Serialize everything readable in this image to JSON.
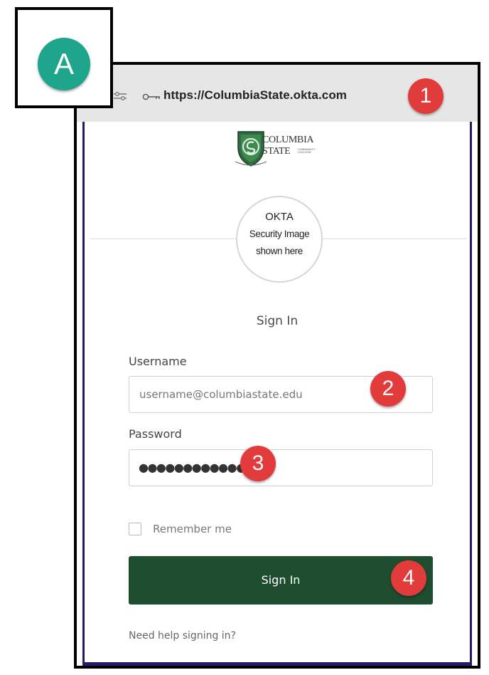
{
  "browser": {
    "url": "https://ColumbiaState.okta.com",
    "tune_icon": "tune-icon",
    "key_icon": "key-icon"
  },
  "logo": {
    "line1": "COLUMBIA",
    "line2": "STATE",
    "small_text": "COMMUNITY COLLEGE",
    "emblem": "cs-shield-logo"
  },
  "security_image": {
    "line1": "OKTA",
    "line2": "Security Image",
    "line3": "shown here"
  },
  "form": {
    "heading": "Sign In",
    "username_label": "Username",
    "username_value": "username@columbiastate.edu",
    "password_label": "Password",
    "password_mask": "●●●●●●●●●●●●",
    "remember_label": "Remember me",
    "remember_checked": false,
    "submit_label": "Sign In",
    "help_link": "Need help signing in?"
  },
  "callouts": {
    "a": "A",
    "one": "1",
    "two": "2",
    "three": "3",
    "four": "4"
  },
  "colors": {
    "brand_green": "#1e4d2f",
    "callout_red": "#e23b3b",
    "callout_teal": "#1fa58b",
    "frame_border": "#241a6a"
  }
}
